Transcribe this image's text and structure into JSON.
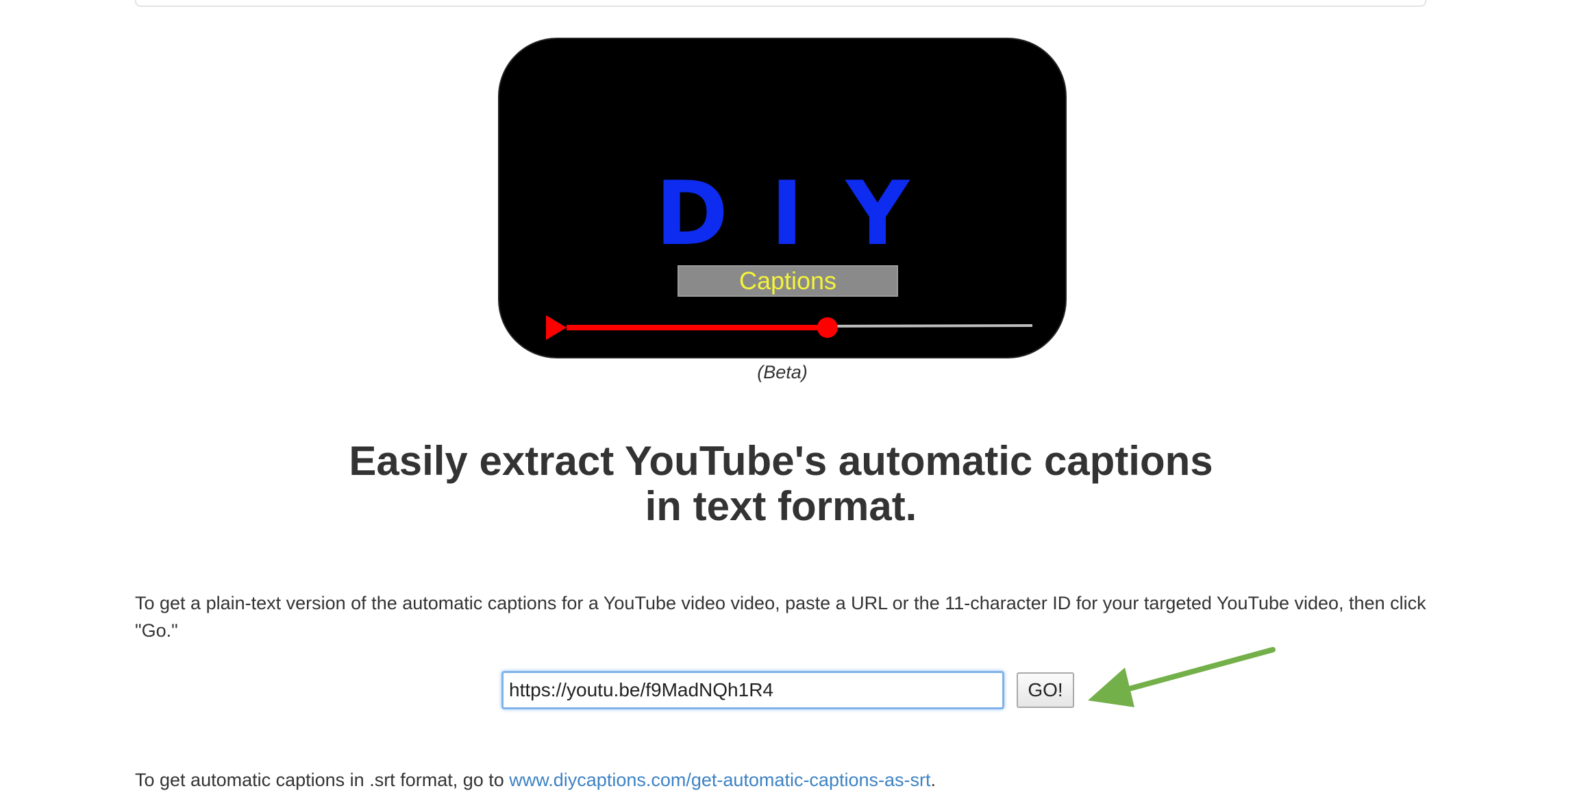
{
  "logo": {
    "title": "DIY",
    "caption": "Captions",
    "progress": 0.56,
    "colors": {
      "title": "#0d2cf0",
      "caption_text": "#f4f43a",
      "caption_box": "#8a8a8a",
      "progress": "#ff0000",
      "track": "#bdbdbd"
    }
  },
  "beta_label": "(Beta)",
  "headline": {
    "line1": "Easily extract YouTube's automatic captions",
    "line2": "in text format."
  },
  "instructions": "To get a plain-text version of the automatic captions for a YouTube video video, paste a URL or the 11-character ID for your targeted YouTube video, then click \"Go.\"",
  "form": {
    "url_value": "https://youtu.be/f9MadNQh1R4",
    "go_label": "GO!"
  },
  "annotation": {
    "arrow_color": "#74b04a"
  },
  "srt": {
    "prefix": "To get automatic captions in .srt format, go to ",
    "link_text": "www.diycaptions.com/get-automatic-captions-as-srt",
    "suffix": "."
  }
}
